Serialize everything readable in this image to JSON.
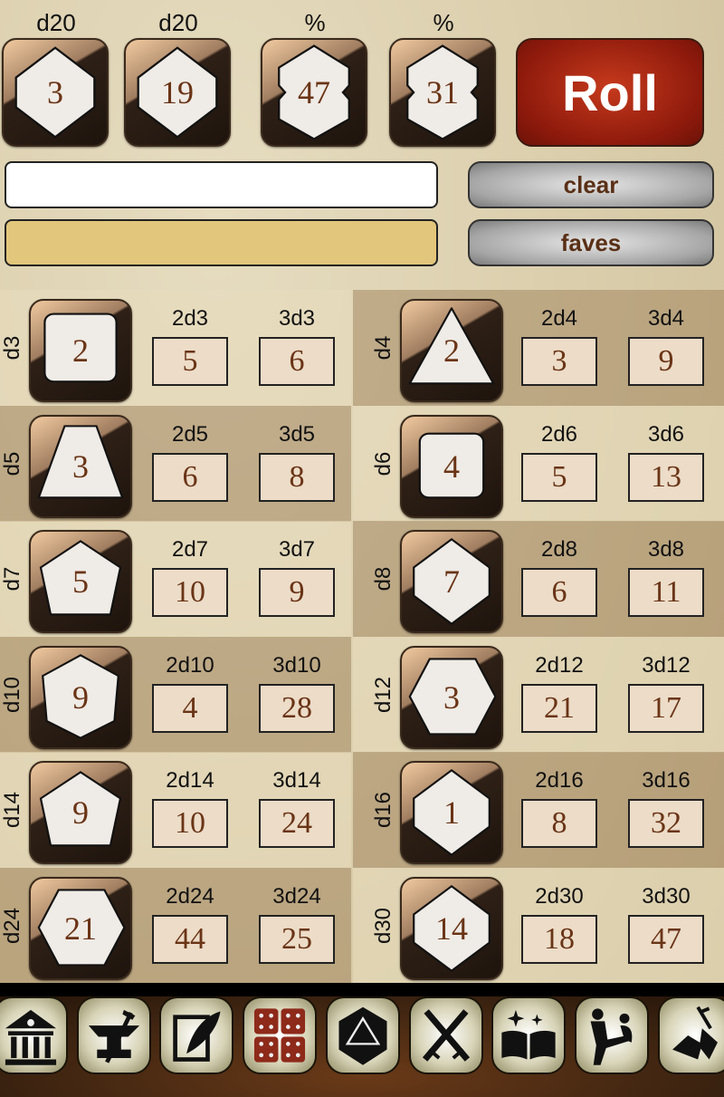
{
  "top_dice": [
    {
      "label": "d20",
      "value": "3",
      "shape": "hexagon"
    },
    {
      "label": "d20",
      "value": "19",
      "shape": "hexagon"
    },
    {
      "label": "%",
      "value": "47",
      "shape": "notched-hex"
    },
    {
      "label": "%",
      "value": "31",
      "shape": "notched-hex"
    }
  ],
  "roll_label": "Roll",
  "input_value": "",
  "result_value": "",
  "clear_label": "clear",
  "faves_label": "faves",
  "dice": [
    {
      "die": "d3",
      "value": "2",
      "shape": "rounded-square",
      "l2": "2d3",
      "v2": "5",
      "l3": "3d3",
      "v3": "6"
    },
    {
      "die": "d4",
      "value": "2",
      "shape": "triangle",
      "l2": "2d4",
      "v2": "3",
      "l3": "3d4",
      "v3": "9"
    },
    {
      "die": "d5",
      "value": "3",
      "shape": "trapezoid",
      "l2": "2d5",
      "v2": "6",
      "l3": "3d5",
      "v3": "8"
    },
    {
      "die": "d6",
      "value": "4",
      "shape": "rounded-square-small",
      "l2": "2d6",
      "v2": "5",
      "l3": "3d6",
      "v3": "13"
    },
    {
      "die": "d7",
      "value": "5",
      "shape": "pentagon",
      "l2": "2d7",
      "v2": "10",
      "l3": "3d7",
      "v3": "9"
    },
    {
      "die": "d8",
      "value": "7",
      "shape": "hexagon",
      "l2": "2d8",
      "v2": "6",
      "l3": "3d8",
      "v3": "11"
    },
    {
      "die": "d10",
      "value": "9",
      "shape": "kite",
      "l2": "2d10",
      "v2": "4",
      "l3": "3d10",
      "v3": "28"
    },
    {
      "die": "d12",
      "value": "3",
      "shape": "hexagon-flat",
      "l2": "2d12",
      "v2": "21",
      "l3": "3d12",
      "v3": "17"
    },
    {
      "die": "d14",
      "value": "9",
      "shape": "pentagon",
      "l2": "2d14",
      "v2": "10",
      "l3": "3d14",
      "v3": "24"
    },
    {
      "die": "d16",
      "value": "1",
      "shape": "hexagon",
      "l2": "2d16",
      "v2": "8",
      "l3": "3d16",
      "v3": "32"
    },
    {
      "die": "d24",
      "value": "21",
      "shape": "hexagon-flat",
      "l2": "2d24",
      "v2": "44",
      "l3": "3d24",
      "v3": "25"
    },
    {
      "die": "d30",
      "value": "14",
      "shape": "hexagon",
      "l2": "2d30",
      "v2": "18",
      "l3": "3d30",
      "v3": "47"
    }
  ],
  "toolbar": [
    "temple-icon",
    "anvil-hammer-icon",
    "quill-note-icon",
    "dice-icon",
    "d20-icon",
    "crossed-swords-icon",
    "spellbook-icon",
    "brawl-icon",
    "knockdown-icon"
  ],
  "colors": {
    "roll": "#a8200e",
    "die_number": "#6a3416",
    "result_field": "#e2c67c",
    "selected_tool": "#8e2a1a"
  }
}
